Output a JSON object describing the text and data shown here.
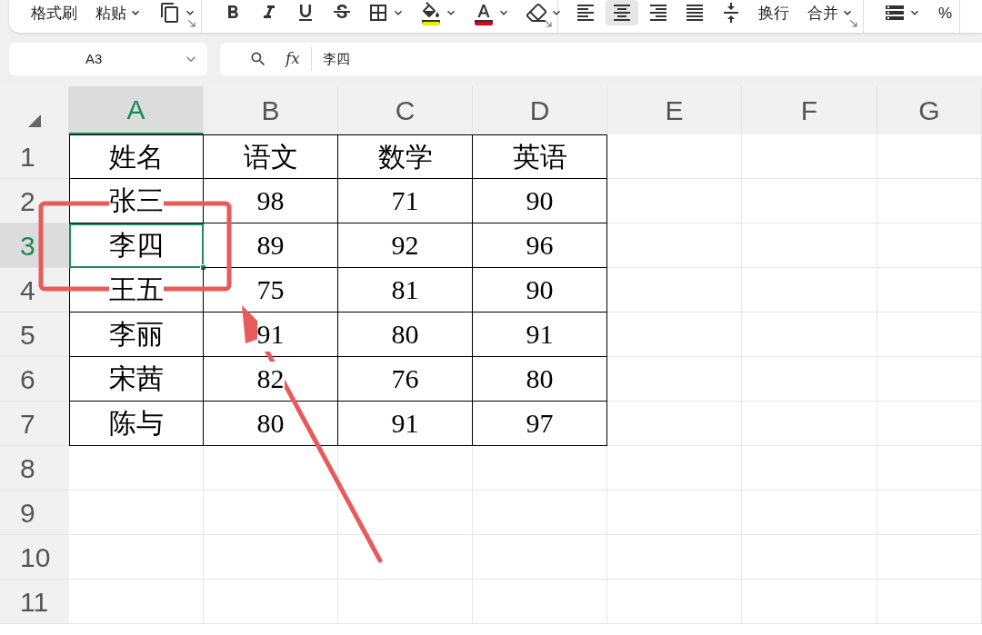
{
  "toolbar": {
    "groups": [
      {
        "launcher": true,
        "items": [
          {
            "kind": "label",
            "text": "格式刷",
            "dropdown": false
          },
          {
            "kind": "label",
            "text": "粘贴",
            "dropdown": true
          },
          {
            "kind": "copy",
            "dropdown": true
          }
        ]
      },
      {
        "launcher": true,
        "items": [
          {
            "kind": "bold",
            "dropdown": false
          },
          {
            "kind": "italic",
            "dropdown": false
          },
          {
            "kind": "underline",
            "dropdown": false
          },
          {
            "kind": "strike",
            "dropdown": false
          },
          {
            "kind": "borders",
            "dropdown": true
          },
          {
            "kind": "fill",
            "dropdown": true,
            "color": "#e8f000"
          },
          {
            "kind": "font_color",
            "dropdown": true,
            "color": "#d9001b"
          },
          {
            "kind": "clear",
            "dropdown": true
          }
        ]
      },
      {
        "launcher": true,
        "items": [
          {
            "kind": "align_left",
            "dropdown": false,
            "selected": false
          },
          {
            "kind": "align_center",
            "dropdown": false,
            "selected": true
          },
          {
            "kind": "align_right",
            "dropdown": false,
            "selected": false
          },
          {
            "kind": "justify",
            "dropdown": false,
            "selected": false
          },
          {
            "kind": "distribute",
            "dropdown": false,
            "selected": false
          },
          {
            "kind": "label",
            "text": "换行",
            "dropdown": false
          },
          {
            "kind": "label",
            "text": "合并",
            "dropdown": true
          }
        ]
      },
      {
        "items": [
          {
            "kind": "database",
            "dropdown": true
          },
          {
            "kind": "label",
            "text": "%",
            "dropdown": false
          }
        ]
      }
    ]
  },
  "name_box": {
    "value": "A3"
  },
  "formula_bar": {
    "fx": "fx",
    "value": "李四"
  },
  "sheet": {
    "columns": [
      {
        "label": "A",
        "selected": true
      },
      {
        "label": "B",
        "selected": false
      },
      {
        "label": "C",
        "selected": false
      },
      {
        "label": "D",
        "selected": false
      },
      {
        "label": "E",
        "selected": false
      },
      {
        "label": "F",
        "selected": false
      },
      {
        "label": "G",
        "selected": false
      }
    ],
    "rows": [
      {
        "label": "1",
        "selected": false,
        "cells": [
          {
            "text": "姓名",
            "selected": false
          },
          {
            "text": "语文",
            "selected": false
          },
          {
            "text": "数学",
            "selected": false
          },
          {
            "text": "英语",
            "selected": false
          }
        ]
      },
      {
        "label": "2",
        "selected": false,
        "cells": [
          {
            "text": "张三",
            "selected": false
          },
          {
            "text": "98",
            "selected": false
          },
          {
            "text": "71",
            "selected": false
          },
          {
            "text": "90",
            "selected": false
          }
        ]
      },
      {
        "label": "3",
        "selected": true,
        "cells": [
          {
            "text": "李四",
            "selected": true
          },
          {
            "text": "89",
            "selected": false
          },
          {
            "text": "92",
            "selected": false
          },
          {
            "text": "96",
            "selected": false
          }
        ]
      },
      {
        "label": "4",
        "selected": false,
        "cells": [
          {
            "text": "王五",
            "selected": false
          },
          {
            "text": "75",
            "selected": false
          },
          {
            "text": "81",
            "selected": false
          },
          {
            "text": "90",
            "selected": false
          }
        ]
      },
      {
        "label": "5",
        "selected": false,
        "cells": [
          {
            "text": "李丽",
            "selected": false
          },
          {
            "text": "91",
            "selected": false
          },
          {
            "text": "80",
            "selected": false
          },
          {
            "text": "91",
            "selected": false
          }
        ]
      },
      {
        "label": "6",
        "selected": false,
        "cells": [
          {
            "text": "宋茜",
            "selected": false
          },
          {
            "text": "82",
            "selected": false
          },
          {
            "text": "76",
            "selected": false
          },
          {
            "text": "80",
            "selected": false
          }
        ]
      },
      {
        "label": "7",
        "selected": false,
        "cells": [
          {
            "text": "陈与",
            "selected": false
          },
          {
            "text": "80",
            "selected": false
          },
          {
            "text": "91",
            "selected": false
          },
          {
            "text": "97",
            "selected": false
          }
        ]
      },
      {
        "label": "8",
        "selected": false
      },
      {
        "label": "9",
        "selected": false
      },
      {
        "label": "10",
        "selected": false
      },
      {
        "label": "11",
        "selected": false
      }
    ]
  }
}
